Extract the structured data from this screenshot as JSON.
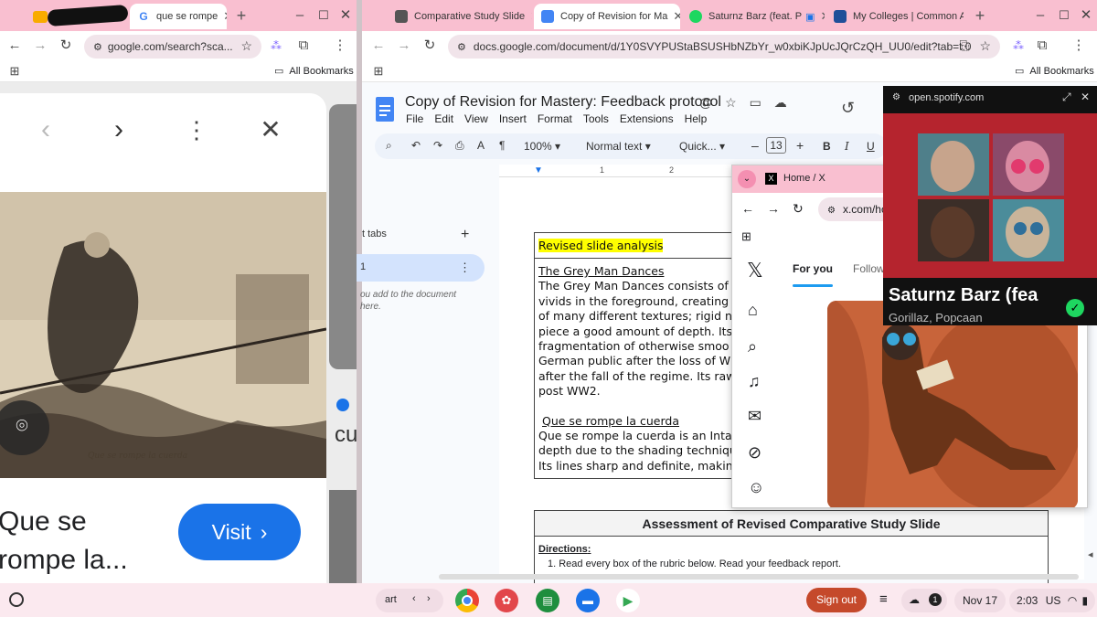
{
  "left_window": {
    "tabs": [
      {
        "label": "que se rompe"
      }
    ],
    "url": "google.com/search?sca...",
    "bookmarks_label": "All Bookmarks",
    "result_title": "Que se rompe la...",
    "visit_button": "Visit",
    "image_caption": "Que se rompe la cuerda",
    "partial_text": "cu"
  },
  "right_window": {
    "tabs": [
      {
        "label": "Comparative Study Slide"
      },
      {
        "label": "Copy of Revision for Ma"
      },
      {
        "label": "Saturnz Barz (feat. P"
      },
      {
        "label": "My Colleges | Common A"
      }
    ],
    "url": "docs.google.com/document/d/1Y0SVYPUStaBSUSHbNZbYr_w0xbiKJpUcJQrCzQH_UU0/edit?tab=t.0",
    "bookmarks_label": "All Bookmarks"
  },
  "docs": {
    "title": "Copy of Revision for Mastery: Feedback protocol",
    "menu": [
      "File",
      "Edit",
      "View",
      "Insert",
      "Format",
      "Tools",
      "Extensions",
      "Help"
    ],
    "zoom": "100%",
    "style": "Normal text",
    "font": "Quick...",
    "font_size": "13",
    "bold": "B",
    "italic": "I",
    "underline": "U",
    "ruler": [
      "1",
      "2"
    ],
    "sidebar_title": "t tabs",
    "sidebar_add": "+",
    "sidebar_tab": "1",
    "sidebar_hint_1": "ou add to the document",
    "sidebar_hint_2": "here.",
    "box_heading": "Revised slide analysis",
    "section1_title": "The Grey Man Dances",
    "section1_lines": [
      "The Grey Man Dances consists of",
      "vivids in the foreground, creating d",
      "of many different textures; rigid ne",
      "piece a good amount of depth. Its",
      "fragmentation of otherwise smoo",
      "German public after the loss of W",
      "after the fall of the regime. Its raw",
      "post WW2."
    ],
    "section2_title": "Que se rompe la cuerda",
    "section2_lines": [
      "Que se rompe la cuerda is an Inta",
      "depth due to the shading techniqu",
      "Its lines sharp and definite, making"
    ],
    "assessment_title": "Assessment of Revised Comparative Study Slide",
    "directions_label": "Directions",
    "directions_item": "1.   Read every box of the rubric below. Read your feedback report."
  },
  "x_window": {
    "title": "Home / X",
    "url": "x.com/ho",
    "tabs": [
      "For you",
      "Follow"
    ]
  },
  "spotify": {
    "domain": "open.spotify.com",
    "track": "Saturnz Barz (fea",
    "artists": "Gorillaz, Popcaan"
  },
  "shelf": {
    "launcher_text": "art",
    "sign_out": "Sign out",
    "notification_count": "1",
    "date": "Nov 17",
    "time": "2:03",
    "locale": "US"
  },
  "colors": {
    "tab_strip": "#f9bfd0",
    "visit_button": "#1a73e8",
    "sign_out": "#c5492b",
    "highlight": "#ffff00",
    "spotify_green": "#1ed760"
  }
}
